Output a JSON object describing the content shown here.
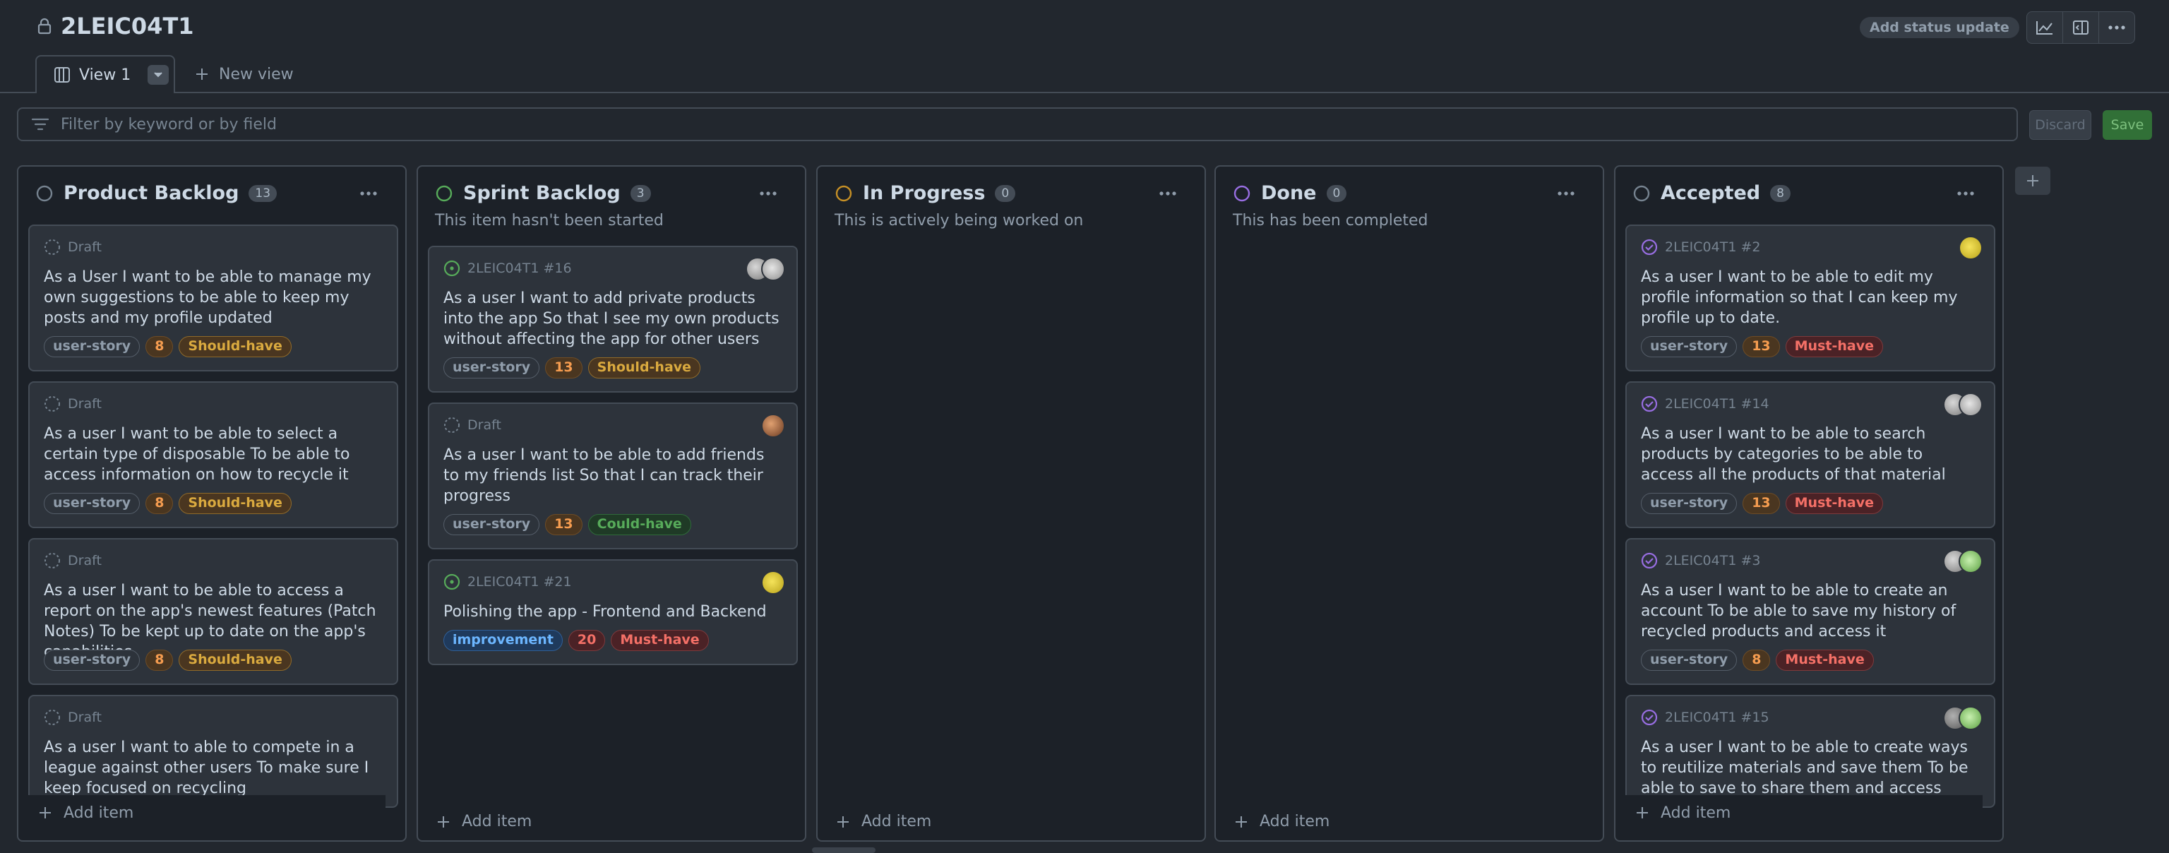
{
  "header": {
    "title": "2LEIC04T1",
    "status_button": "Add status update"
  },
  "tabs": {
    "active": "View 1",
    "new_view": "New view"
  },
  "filter": {
    "placeholder": "Filter by keyword or by field",
    "discard_label": "Discard",
    "save_label": "Save"
  },
  "columns": [
    {
      "title": "Product Backlog",
      "count": "13",
      "status_color": "#768390",
      "description": "",
      "add_label": "Add item",
      "cards": [
        {
          "meta": "Draft",
          "kind": "draft",
          "title": "As a User I want to be able to manage my own suggestions to be able to keep my posts and my profile updated",
          "labels": [
            "user-story",
            "8",
            "Should-have"
          ]
        },
        {
          "meta": "Draft",
          "kind": "draft",
          "title": "As a user I want to be able to select a certain type of disposable To be able to access information on how to recycle it",
          "labels": [
            "user-story",
            "8",
            "Should-have"
          ]
        },
        {
          "meta": "Draft",
          "kind": "draft",
          "title": "As a user I want to be able to access a report on the app's newest features (Patch Notes) To be kept up to date on the app's capabilities",
          "labels": [
            "user-story",
            "8",
            "Should-have"
          ]
        },
        {
          "meta": "Draft",
          "kind": "draft",
          "title": "As a user I want to able to compete in a league against other users To make sure I keep focused on recycling",
          "labels": []
        }
      ]
    },
    {
      "title": "Sprint Backlog",
      "count": "3",
      "status_color": "#57ab5a",
      "description": "This item hasn't been started",
      "add_label": "Add item",
      "cards": [
        {
          "meta": "2LEIC04T1 #16",
          "kind": "open",
          "title": "As a user I want to add private products into the app So that I see my own products without affecting the app for other users",
          "labels": [
            "user-story",
            "13",
            "Should-have"
          ]
        },
        {
          "meta": "Draft",
          "kind": "draft",
          "title": "As a user I want to be able to add friends to my friends list So that I can track their progress",
          "labels": [
            "user-story",
            "13",
            "Could-have"
          ]
        },
        {
          "meta": "2LEIC04T1 #21",
          "kind": "open",
          "title": "Polishing the app - Frontend and Backend",
          "labels": [
            "improvement",
            "20",
            "Must-have"
          ]
        }
      ]
    },
    {
      "title": "In Progress",
      "count": "0",
      "status_color": "#c69026",
      "description": "This is actively being worked on",
      "add_label": "Add item",
      "cards": []
    },
    {
      "title": "Done",
      "count": "0",
      "status_color": "#986ee2",
      "description": "This has been completed",
      "add_label": "Add item",
      "cards": []
    },
    {
      "title": "Accepted",
      "count": "8",
      "status_color": "#768390",
      "description": "",
      "add_label": "Add item",
      "cards": [
        {
          "meta": "2LEIC04T1 #2",
          "kind": "closed",
          "title": "As a user I want to be able to edit my profile information so that I can keep my profile up to date.",
          "labels": [
            "user-story",
            "13",
            "Must-have"
          ]
        },
        {
          "meta": "2LEIC04T1 #14",
          "kind": "closed",
          "title": "As a user I want to be able to search products by categories to be able to access all the products of that material",
          "labels": [
            "user-story",
            "13",
            "Must-have"
          ]
        },
        {
          "meta": "2LEIC04T1 #3",
          "kind": "closed",
          "title": "As a user I want to be able to create an account To be able to save my history of recycled products and access it",
          "labels": [
            "user-story",
            "8",
            "Must-have"
          ]
        },
        {
          "meta": "2LEIC04T1 #15",
          "kind": "closed",
          "title": "As a user I want to be able to create ways to reutilize materials and save them To be able to save to share them and access them later",
          "labels": []
        }
      ]
    }
  ],
  "icons": {
    "lock": "lock-icon",
    "insights": "chart-icon",
    "panel": "sidebar-icon",
    "more": "kebab-icon"
  }
}
